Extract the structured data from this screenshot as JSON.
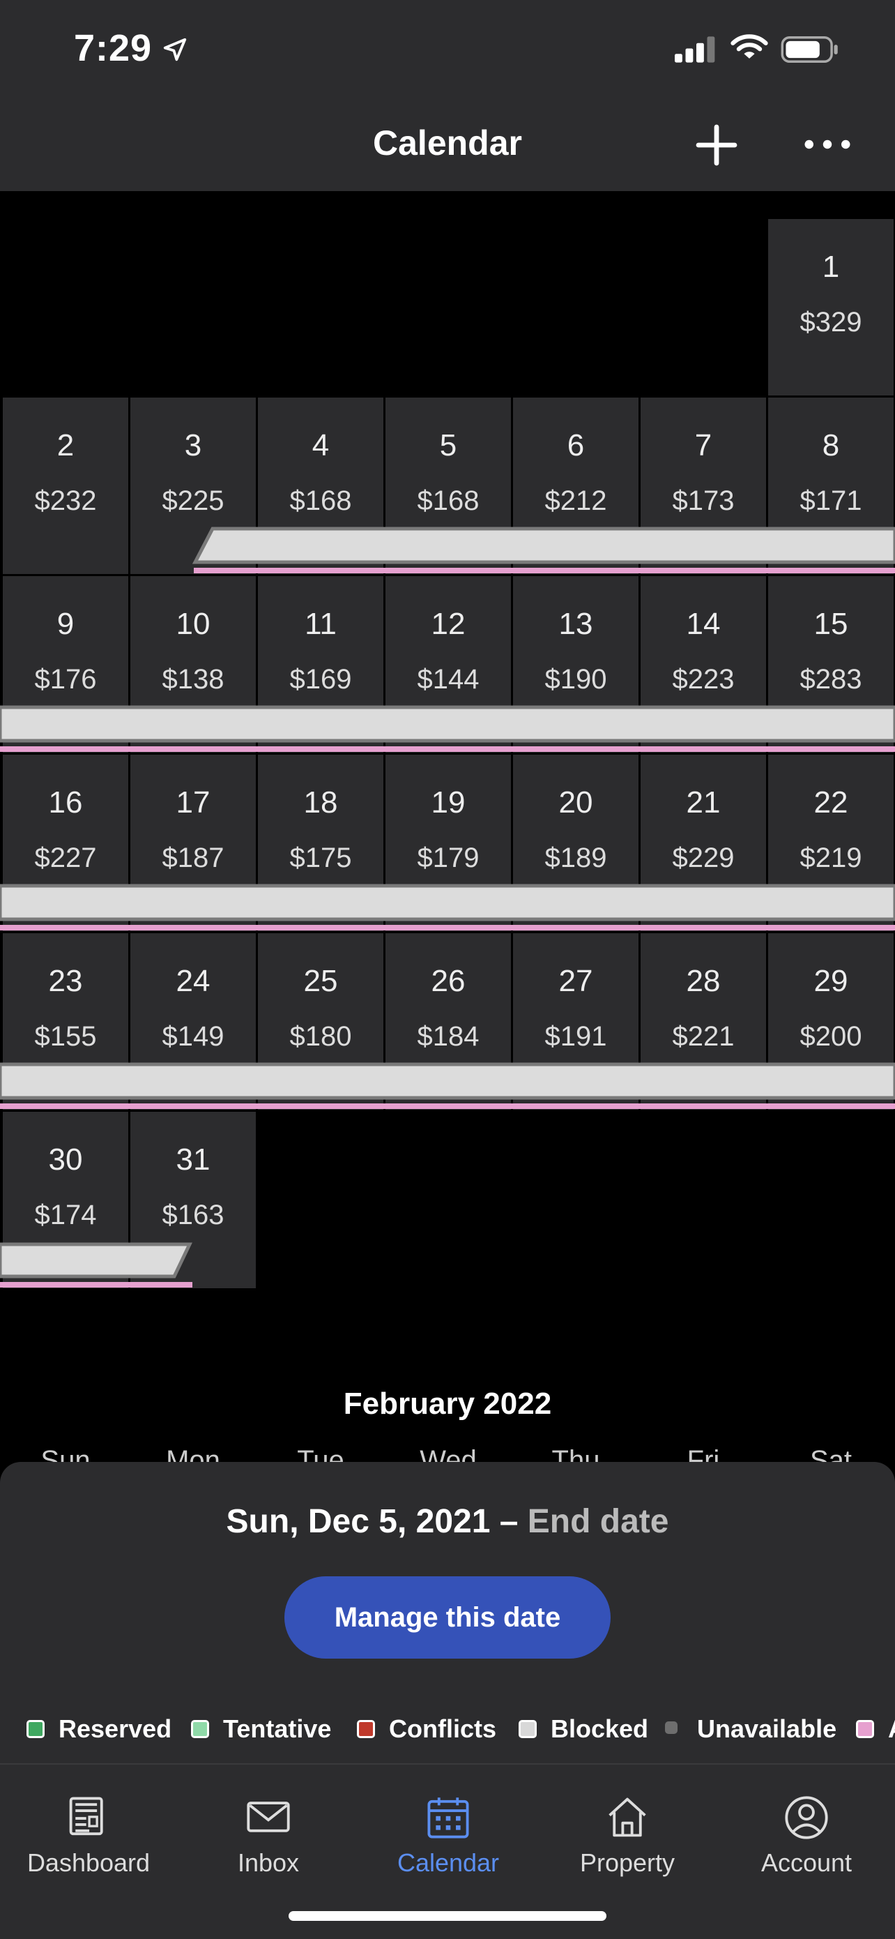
{
  "status_bar": {
    "time": "7:29"
  },
  "header": {
    "title": "Calendar"
  },
  "calendar": {
    "days": [
      {
        "day": "1",
        "price": "$329"
      },
      {
        "day": "2",
        "price": "$232"
      },
      {
        "day": "3",
        "price": "$225"
      },
      {
        "day": "4",
        "price": "$168"
      },
      {
        "day": "5",
        "price": "$168"
      },
      {
        "day": "6",
        "price": "$212"
      },
      {
        "day": "7",
        "price": "$173"
      },
      {
        "day": "8",
        "price": "$171"
      },
      {
        "day": "9",
        "price": "$176"
      },
      {
        "day": "10",
        "price": "$138"
      },
      {
        "day": "11",
        "price": "$169"
      },
      {
        "day": "12",
        "price": "$144"
      },
      {
        "day": "13",
        "price": "$190"
      },
      {
        "day": "14",
        "price": "$223"
      },
      {
        "day": "15",
        "price": "$283"
      },
      {
        "day": "16",
        "price": "$227"
      },
      {
        "day": "17",
        "price": "$187"
      },
      {
        "day": "18",
        "price": "$175"
      },
      {
        "day": "19",
        "price": "$179"
      },
      {
        "day": "20",
        "price": "$189"
      },
      {
        "day": "21",
        "price": "$229"
      },
      {
        "day": "22",
        "price": "$219"
      },
      {
        "day": "23",
        "price": "$155"
      },
      {
        "day": "24",
        "price": "$149"
      },
      {
        "day": "25",
        "price": "$180"
      },
      {
        "day": "26",
        "price": "$184"
      },
      {
        "day": "27",
        "price": "$191"
      },
      {
        "day": "28",
        "price": "$221"
      },
      {
        "day": "29",
        "price": "$200"
      },
      {
        "day": "30",
        "price": "$174"
      },
      {
        "day": "31",
        "price": "$163"
      }
    ],
    "next_month": "February 2022",
    "weekdays": [
      "Sun",
      "Mon",
      "Tue",
      "Wed",
      "Thu",
      "Fri",
      "Sat"
    ]
  },
  "selection": {
    "date": "Sun, Dec 5, 2021 –",
    "role": "End date",
    "manage_label": "Manage this date"
  },
  "legend": [
    {
      "label": "Reserved",
      "color": "#3fa860"
    },
    {
      "label": "Tentative",
      "color": "#8fd9a8"
    },
    {
      "label": "Conflicts",
      "color": "#c0392b"
    },
    {
      "label": "Blocked",
      "color": "#d8d8d8"
    },
    {
      "label": "Unavailable",
      "color": "#6e6e6e"
    },
    {
      "label": "A",
      "color": "#e6a0cf"
    }
  ],
  "tabs": [
    {
      "label": "Dashboard",
      "icon": "dashboard-icon"
    },
    {
      "label": "Inbox",
      "icon": "inbox-icon"
    },
    {
      "label": "Calendar",
      "icon": "calendar-icon",
      "active": true
    },
    {
      "label": "Property",
      "icon": "property-icon"
    },
    {
      "label": "Account",
      "icon": "account-icon"
    }
  ],
  "colors": {
    "accent": "#5b8ef0",
    "button": "#3552b8",
    "booking_bar": "#dcdcdc",
    "booking_underline": "#e6a0cf"
  }
}
